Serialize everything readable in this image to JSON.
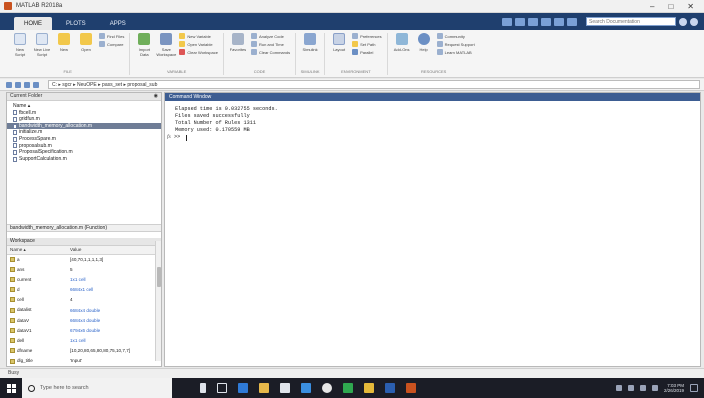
{
  "window": {
    "title": "MATLAB R2018a",
    "controls": [
      "–",
      "□",
      "✕"
    ]
  },
  "tabs": [
    {
      "label": "HOME",
      "active": true
    },
    {
      "label": "PLOTS",
      "active": false
    },
    {
      "label": "APPS",
      "active": false
    }
  ],
  "search": {
    "placeholder": "Search Documentation"
  },
  "toolstrip": {
    "groups": [
      {
        "label": "FILE",
        "buttons": [
          "New Script",
          "New Live Script",
          "New",
          "Open"
        ],
        "small": [
          "Find Files",
          "Compare"
        ]
      },
      {
        "label": "VARIABLE",
        "buttons": [
          "Import Data",
          "Save Workspace"
        ],
        "small": [
          "New Variable",
          "Open Variable",
          "Clear Workspace"
        ]
      },
      {
        "label": "CODE",
        "buttons": [
          "Favorites"
        ],
        "small": [
          "Analyze Code",
          "Run and Time",
          "Clear Commands"
        ]
      },
      {
        "label": "SIMULINK",
        "buttons": [
          "Simulink"
        ],
        "small": []
      },
      {
        "label": "ENVIRONMENT",
        "buttons": [
          "Layout"
        ],
        "small": [
          "Preferences",
          "Set Path",
          "Parallel"
        ]
      },
      {
        "label": "RESOURCES",
        "buttons": [
          "Add-Ons",
          "Help"
        ],
        "small": [
          "Community",
          "Request Support",
          "Learn MATLAB"
        ]
      }
    ]
  },
  "address": {
    "path": "C: ▸ sgcr ▸ NeuOPE ▸ pass_set ▸ proposal_sub"
  },
  "current_folder": {
    "title": "Current Folder",
    "name_header": "Name ▴",
    "files": [
      {
        "name": "Name ▴",
        "folder": false,
        "selected": false
      },
      {
        "name": "fbcell.m",
        "folder": false,
        "selected": false
      },
      {
        "name": "gridfun.m",
        "folder": false,
        "selected": false
      },
      {
        "name": "bandwidth_memory_allocation.m",
        "folder": false,
        "selected": true
      },
      {
        "name": "initialize.m",
        "folder": false,
        "selected": false
      },
      {
        "name": "ProcessSpare.m",
        "folder": false,
        "selected": false
      },
      {
        "name": "proposalsub.m",
        "folder": false,
        "selected": false
      },
      {
        "name": "ProposalSpecification.m",
        "folder": false,
        "selected": false
      },
      {
        "name": "SupportCalculation.m",
        "folder": false,
        "selected": false
      }
    ],
    "details_label": "bandwidth_memory_allocation.m (Function)"
  },
  "workspace": {
    "title": "Workspace",
    "headers": [
      "Name ▴",
      "Value"
    ],
    "rows": [
      {
        "name": "a",
        "value": "[40,70,1,1,1,1,3]",
        "link": false
      },
      {
        "name": "ans",
        "value": "5",
        "link": false
      },
      {
        "name": "current",
        "value": "1x1 cell",
        "link": true
      },
      {
        "name": "d",
        "value": "6684x1 cell",
        "link": true
      },
      {
        "name": "cell",
        "value": "4",
        "link": false
      },
      {
        "name": "datalist",
        "value": "6684x4 double",
        "link": true
      },
      {
        "name": "dataV",
        "value": "6684x4 double",
        "link": true
      },
      {
        "name": "dataV1",
        "value": "6794x6 double",
        "link": true
      },
      {
        "name": "dell",
        "value": "1x1 cell",
        "link": true
      },
      {
        "name": "dfname",
        "value": "[10,20,80,65,80,80,75,10,7,7]",
        "link": false
      },
      {
        "name": "dlg_title",
        "value": "'Input'",
        "link": false
      }
    ]
  },
  "command_window": {
    "title": "Command Window",
    "lines": [
      "Elapsed time is 0.032755 seconds.",
      "Files saved successfully",
      "Total Number of Rules 1311",
      "Memory used: 0.170559 MB"
    ],
    "prompt_fx": "fx",
    "prompt": ">> "
  },
  "status": {
    "text": "Busy"
  },
  "taskbar": {
    "search_placeholder": "Type here to search",
    "time": "7:03 PM",
    "date": "2/26/2019"
  },
  "colors": {
    "ribbon_blue": "#1f3f6e",
    "command_header": "#3d5d92",
    "selection": "#6f7d96",
    "taskbar": "#1b1d26"
  }
}
